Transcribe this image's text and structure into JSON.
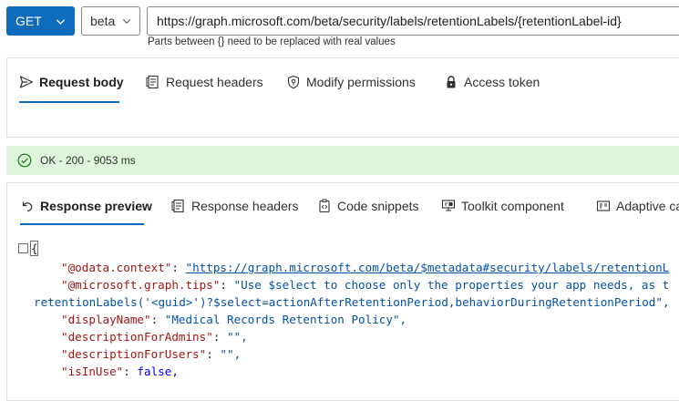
{
  "request": {
    "method": "GET",
    "version": "beta",
    "url": "https://graph.microsoft.com/beta/security/labels/retentionLabels/{retentionLabel-id}",
    "hint": "Parts between {} need to be replaced with real values"
  },
  "request_tabs": [
    {
      "label": "Request body",
      "icon": "send-icon"
    },
    {
      "label": "Request headers",
      "icon": "document-icon"
    },
    {
      "label": "Modify permissions",
      "icon": "shield-key-icon"
    },
    {
      "label": "Access token",
      "icon": "lock-icon"
    }
  ],
  "status": {
    "text": "OK - 200 - 9053 ms",
    "color": "#dff6dd"
  },
  "response_tabs": [
    {
      "label": "Response preview",
      "icon": "undo-arrow-icon"
    },
    {
      "label": "Response headers",
      "icon": "document-icon"
    },
    {
      "label": "Code snippets",
      "icon": "clipboard-code-icon"
    },
    {
      "label": "Toolkit component",
      "icon": "toolkit-icon"
    },
    {
      "label": "Adaptive ca",
      "icon": "card-icon"
    }
  ],
  "response": {
    "open_brace": "{",
    "lines": [
      {
        "key": "\"@odata.context\"",
        "sep": ": ",
        "value": "\"https://graph.microsoft.com/beta/$metadata#security/labels/retentionL",
        "type": "url"
      },
      {
        "key": "\"@microsoft.graph.tips\"",
        "sep": ": ",
        "value": "\"Use $select to choose only the properties your app needs, as t",
        "type": "string"
      },
      {
        "cont": "retentionLabels('<guid>')?$select=actionAfterRetentionPeriod,behaviorDuringRetentionPeriod\","
      },
      {
        "key": "\"displayName\"",
        "sep": ": ",
        "value": "\"Medical Records Retention Policy\",",
        "type": "string"
      },
      {
        "key": "\"descriptionForAdmins\"",
        "sep": ": ",
        "value": "\"\",",
        "type": "string"
      },
      {
        "key": "\"descriptionForUsers\"",
        "sep": ": ",
        "value": "\"\",",
        "type": "string"
      },
      {
        "key": "\"isInUse\"",
        "sep": ": ",
        "value": "false,",
        "type": "bool"
      }
    ]
  },
  "colors": {
    "accent": "#0f6cbd",
    "json_key": "#a31515",
    "json_string": "#0451a5"
  }
}
